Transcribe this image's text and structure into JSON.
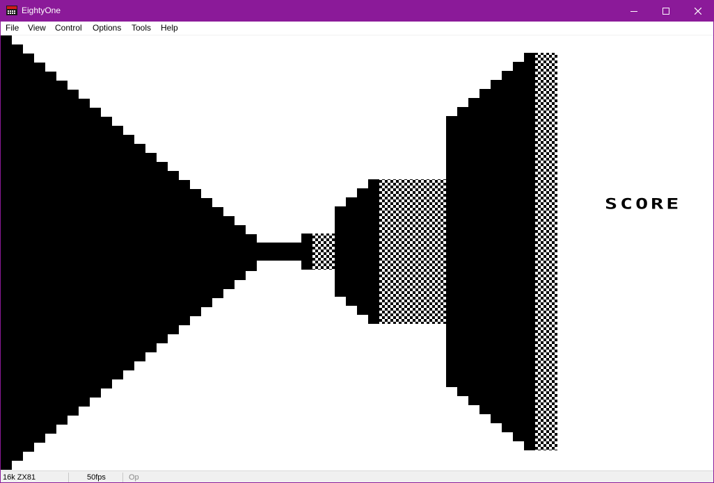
{
  "window": {
    "title": "EightyOne",
    "titlebar_color": "#8b1a99",
    "icon": "eightyone-app-icon",
    "controls": [
      {
        "name": "minimize",
        "icon": "minimize-icon"
      },
      {
        "name": "maximize",
        "icon": "maximize-icon"
      },
      {
        "name": "close",
        "icon": "close-icon"
      }
    ]
  },
  "menu": {
    "items": [
      "File",
      "View",
      "Control",
      "Options",
      "Tools",
      "Help"
    ]
  },
  "game": {
    "score_label": "SCORE",
    "colors": {
      "ink": "#000000",
      "paper": "#ffffff",
      "dither": "checkerboard"
    }
  },
  "status": {
    "machine": "16k ZX81",
    "fps": "50fps",
    "extra": "Op"
  }
}
